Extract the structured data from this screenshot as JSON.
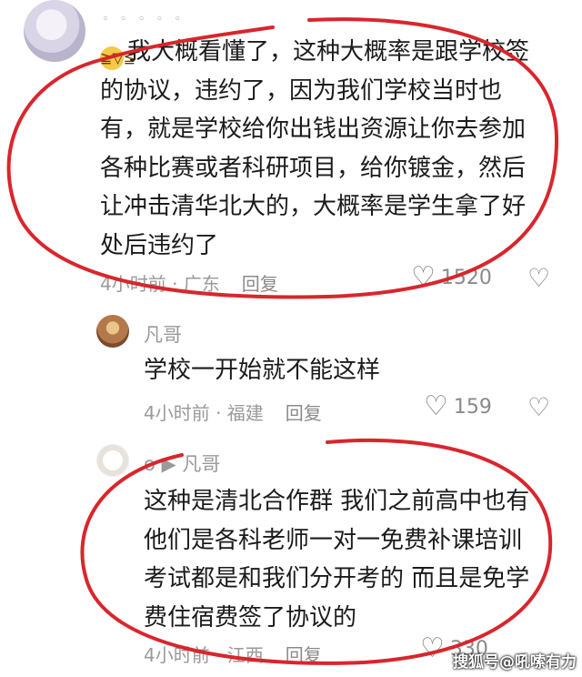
{
  "comment1": {
    "dots": "◦ ◦ ◦ ◦ ◦",
    "emoji_icon": "crying-laughing-emoji",
    "lines": [
      "我大概看懂了，这种大概率是跟学校签",
      "的协议，违约了，因为我们学校当时也",
      "有，就是学校给你出钱出资源让你去参加",
      "各种比赛或者科研项目，给你镀金，然后",
      "让冲击清华北大的，大概率是学生拿了好",
      "处后违约了"
    ],
    "meta": "4小时前 · 广东",
    "reply": "回复",
    "likes": "1520"
  },
  "comment2": {
    "name": "凡哥",
    "text": "学校一开始就不能这样",
    "meta": "4小时前 · 福建",
    "reply": "回复",
    "likes": "159"
  },
  "comment3": {
    "name": "o ▶ 凡哥",
    "lines": [
      "这种是清北合作群 我们之前高中也有",
      "他们是各科老师一对一免费补课培训",
      "考试都是和我们分开考的 而且是免学",
      "费住宿费签了协议的"
    ],
    "meta": "4小时前 · 江西",
    "reply": "回复",
    "likes": "330"
  },
  "watermark": "搜狐号@吼嗦有力",
  "colors": {
    "annotation": "#d8262c",
    "text": "#1b1b1b",
    "meta": "#9a9a9a"
  }
}
